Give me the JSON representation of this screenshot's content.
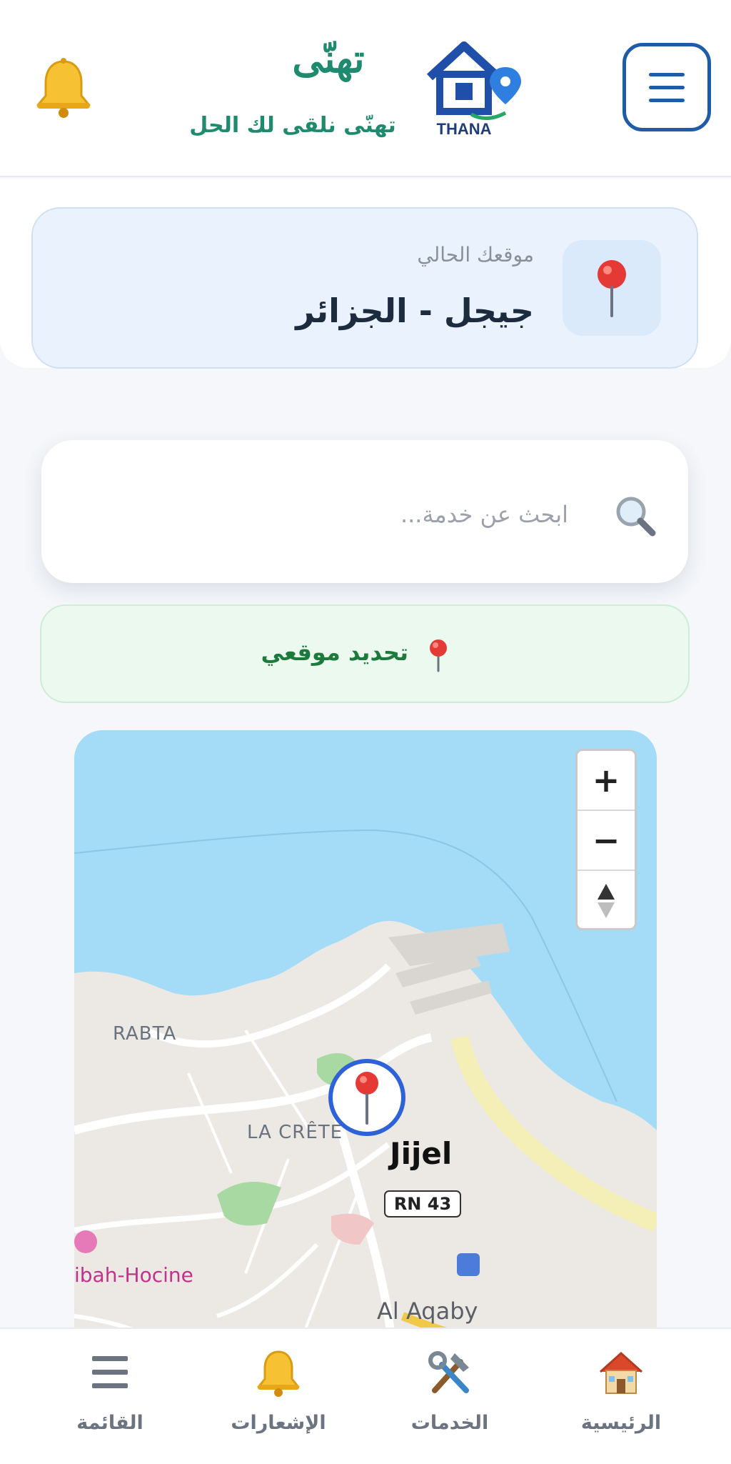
{
  "header": {
    "app_title": "تهنّى",
    "tagline": "تهنّى نلقى لك الحل",
    "logo_text": "THANA"
  },
  "location": {
    "label": "موقعك الحالي",
    "value": "جيجل - الجزائر"
  },
  "search": {
    "placeholder": "ابحث عن خدمة..."
  },
  "locate_button": {
    "label": "تحديد موقعي"
  },
  "map": {
    "zoom_in": "+",
    "zoom_out": "−",
    "labels": {
      "rabta": "RABTA",
      "crete": "LA CRÊTE",
      "jijel": "Jijel",
      "road": "RN 43",
      "hocine": "ibah-Hocine",
      "aqaby": "Al Aqaby"
    }
  },
  "nav": {
    "home": "الرئيسية",
    "services": "الخدمات",
    "notifications": "الإشعارات",
    "menu": "القائمة"
  },
  "colors": {
    "primary_blue": "#1f5ca8",
    "brand_green": "#1e8a6e",
    "locate_green": "#1d7a3c",
    "map_water": "#a4dcf7",
    "map_land": "#ece9e4"
  }
}
